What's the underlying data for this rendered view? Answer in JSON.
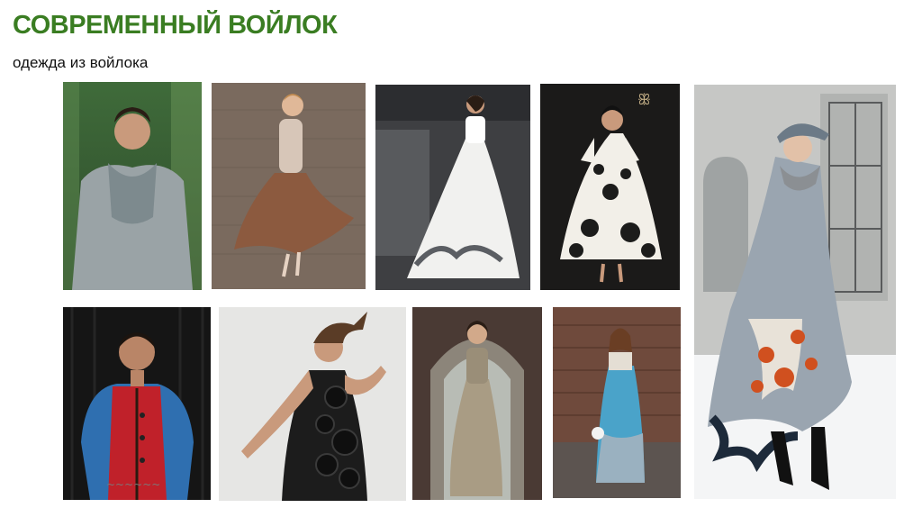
{
  "slide": {
    "title": "СОВРЕМЕННЫЙ ВОЙЛОК",
    "subtitle": "одежда из войлока"
  },
  "photos": [
    {
      "id": "man-grey-felt-coat"
    },
    {
      "id": "woman-brown-felt-skirt"
    },
    {
      "id": "white-felt-gown"
    },
    {
      "id": "black-white-ornament-dress"
    },
    {
      "id": "woman-grey-felt-coat-snow"
    },
    {
      "id": "man-red-felt-vest"
    },
    {
      "id": "woman-black-felt-dress-discs"
    },
    {
      "id": "woman-grey-felt-dress-arch"
    },
    {
      "id": "woman-blue-felt-dress"
    }
  ]
}
